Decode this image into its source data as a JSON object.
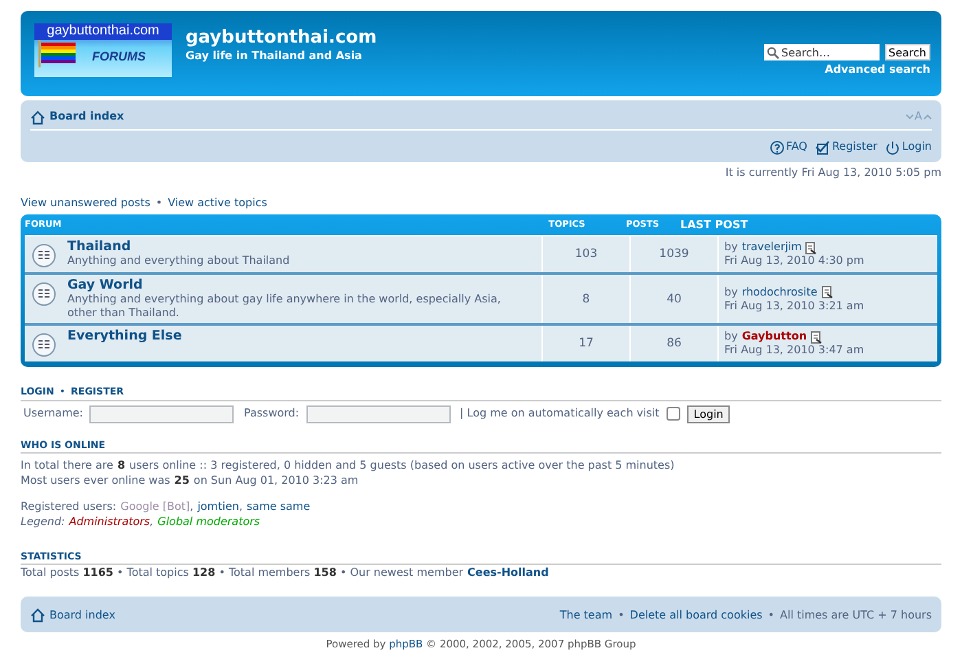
{
  "header": {
    "logo_text": "gaybuttonthai.com",
    "logo_caption": "FORUMS",
    "site_title": "gaybuttonthai.com",
    "site_description": "Gay life in Thailand and Asia",
    "search": {
      "placeholder": "Search…",
      "button": "Search",
      "advanced": "Advanced search"
    }
  },
  "navbar": {
    "breadcrumb": "Board index",
    "font_size": "A",
    "links": [
      {
        "kind": "faq",
        "label": "FAQ"
      },
      {
        "kind": "register",
        "label": "Register"
      },
      {
        "kind": "login",
        "label": "Login"
      }
    ]
  },
  "current_time": "It is currently Fri Aug 13, 2010 5:05 pm",
  "quick_links": [
    {
      "kind": "link",
      "text": "View unanswered posts"
    },
    {
      "kind": "separator",
      "text": "•"
    },
    {
      "kind": "link",
      "text": "View active topics"
    }
  ],
  "forums": {
    "columns": [
      "FORUM",
      "TOPICS",
      "POSTS",
      "LAST POST"
    ],
    "rows": [
      {
        "name": "Thailand",
        "description": "Anything and everything about Thailand",
        "topics": "103",
        "posts": "1039",
        "last_post_by": "by",
        "author": "travelerjim",
        "color": "#105289",
        "author_bold": false,
        "last_post_time": "Fri Aug 13, 2010 4:30 pm"
      },
      {
        "name": "Gay World",
        "description": "Anything and everything about gay life anywhere in the world, especially Asia, other than Thailand.",
        "topics": "8",
        "posts": "40",
        "last_post_by": "by",
        "author": "rhodochrosite",
        "color": "#105289",
        "author_bold": false,
        "last_post_time": "Fri Aug 13, 2010 3:21 am"
      },
      {
        "name": "Everything Else",
        "topics": "17",
        "posts": "86",
        "last_post_by": "by",
        "author": "Gaybutton",
        "color": "#aa0000",
        "author_bold": true,
        "last_post_time": "Fri Aug 13, 2010 3:47 am"
      }
    ]
  },
  "login": {
    "title": [
      {
        "kind": "link",
        "text": "LOGIN"
      },
      {
        "kind": "separator",
        "text": "•"
      },
      {
        "kind": "link",
        "text": "REGISTER"
      }
    ],
    "username_label": "Username:",
    "password_label": "Password:",
    "remember_label": "| Log me on automatically each visit",
    "remember_checked": false,
    "button": "Login"
  },
  "who_is_online": {
    "title": "WHO IS ONLINE",
    "lines": [
      "In total there are **8** users online :: 3 registered, 0 hidden and 5 guests (based on users active over the past 5 minutes)",
      "Most users ever online was **25** on Sun Aug 01, 2010 3:23 am"
    ],
    "registered_label": "Registered users:",
    "registered_users": [
      {
        "name": "Google [Bot]",
        "color": "#9e8da7",
        "separator": ","
      },
      {
        "name": "jomtien",
        "color": "#105289",
        "separator": ","
      },
      {
        "name": "same same",
        "color": "#105289"
      }
    ],
    "legend_label": "Legend:",
    "legend": [
      {
        "name": "Administrators",
        "color": "#aa0000",
        "separator": ","
      },
      {
        "name": "Global moderators",
        "color": "#00aa00"
      }
    ]
  },
  "statistics": {
    "title": "STATISTICS",
    "text": "Total posts **1165** • Total topics **128** • Total members **158** • Our newest member",
    "newest_member": "Cees-Holland"
  },
  "footer_nav": {
    "breadcrumb": "Board index",
    "items": [
      {
        "kind": "link",
        "text": "The team"
      },
      {
        "kind": "separator",
        "text": "•"
      },
      {
        "kind": "link",
        "text": "Delete all board cookies"
      },
      {
        "kind": "separator",
        "text": "•"
      },
      {
        "kind": "text",
        "text": "All times are UTC + 7 hours"
      }
    ]
  },
  "copyright": {
    "prefix": "Powered by",
    "link": "phpBB",
    "suffix": "© 2000, 2002, 2005, 2007 phpBB Group"
  }
}
